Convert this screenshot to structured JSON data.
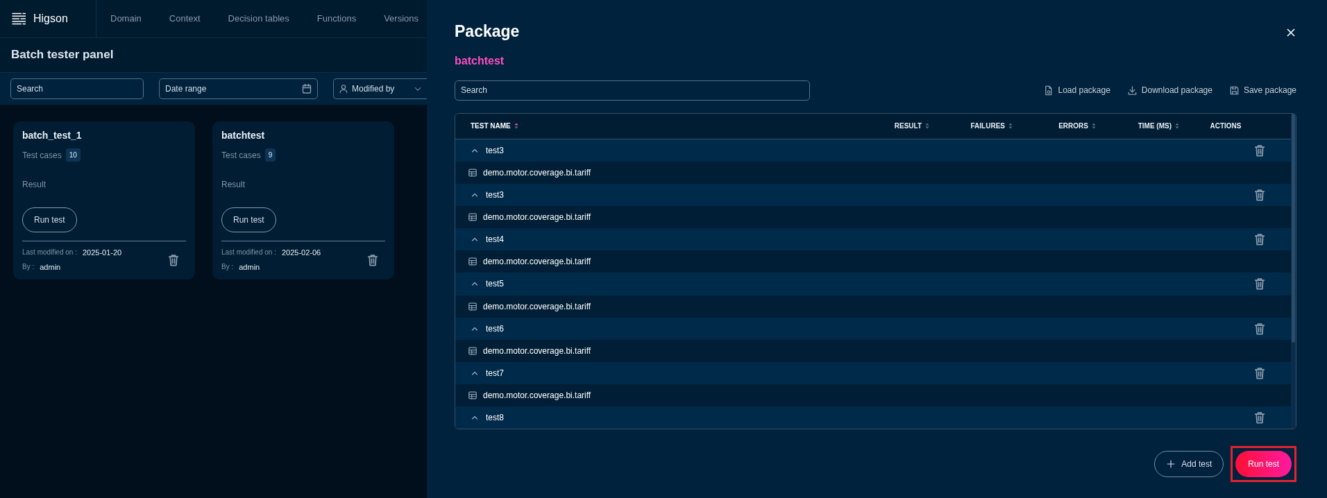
{
  "app": {
    "logo": "Higson",
    "nav": [
      {
        "label": "Domain",
        "selected": false
      },
      {
        "label": "Context",
        "selected": false
      },
      {
        "label": "Decision tables",
        "selected": false
      },
      {
        "label": "Functions",
        "selected": false
      },
      {
        "label": "Versions",
        "selected": false
      }
    ]
  },
  "page": {
    "title": "Batch tester panel",
    "filters": {
      "search": {
        "placeholder": "Search"
      },
      "date": {
        "placeholder": "Date range"
      },
      "modified_by": {
        "placeholder": "Modified by"
      }
    },
    "cards": [
      {
        "name": "batch_test_1",
        "cases_label": "Test cases",
        "cases": "10",
        "result_label": "Result",
        "button": "Run test",
        "modified_label": "Last modified on :",
        "modified": "2025-01-20",
        "by_label": "By :",
        "by": "admin"
      },
      {
        "name": "batchtest",
        "cases_label": "Test cases",
        "cases": "9",
        "result_label": "Result",
        "button": "Run test",
        "modified_label": "Last modified on :",
        "modified": "2025-02-06",
        "by_label": "By :",
        "by": "admin"
      }
    ]
  },
  "drawer": {
    "title": "Package",
    "subtitle": "batchtest",
    "search": {
      "placeholder": "Search"
    },
    "actions": [
      {
        "label": "Load package",
        "kind": "load"
      },
      {
        "label": "Download package",
        "kind": "download"
      },
      {
        "label": "Save package",
        "kind": "save"
      }
    ],
    "table": {
      "columns": [
        {
          "label": "TEST NAME",
          "sortable": true,
          "sorted": true
        },
        {
          "label": "RESULT",
          "sortable": true,
          "sorted": false
        },
        {
          "label": "FAILURES",
          "sortable": true,
          "sorted": false
        },
        {
          "label": "ERRORS",
          "sortable": true,
          "sorted": false
        },
        {
          "label": "TIME (MS)",
          "sortable": true,
          "sorted": false
        },
        {
          "label": "ACTIONS",
          "sortable": false,
          "sorted": false
        }
      ],
      "rows": [
        {
          "name": "test3",
          "expanded": true,
          "children": [
            {
              "name": "demo.motor.coverage.bi.tariff"
            }
          ]
        },
        {
          "name": "test3",
          "expanded": true,
          "children": [
            {
              "name": "demo.motor.coverage.bi.tariff"
            }
          ]
        },
        {
          "name": "test4",
          "expanded": true,
          "children": [
            {
              "name": "demo.motor.coverage.bi.tariff"
            }
          ]
        },
        {
          "name": "test5",
          "expanded": true,
          "children": [
            {
              "name": "demo.motor.coverage.bi.tariff"
            }
          ]
        },
        {
          "name": "test6",
          "expanded": true,
          "children": [
            {
              "name": "demo.motor.coverage.bi.tariff"
            }
          ]
        },
        {
          "name": "test7",
          "expanded": true,
          "children": [
            {
              "name": "demo.motor.coverage.bi.tariff"
            }
          ]
        },
        {
          "name": "test8",
          "expanded": true
        }
      ]
    },
    "buttons": [
      {
        "label": "Add test",
        "kind": "add"
      },
      {
        "label": "Run test",
        "kind": "primary",
        "highlighted": true
      }
    ]
  }
}
